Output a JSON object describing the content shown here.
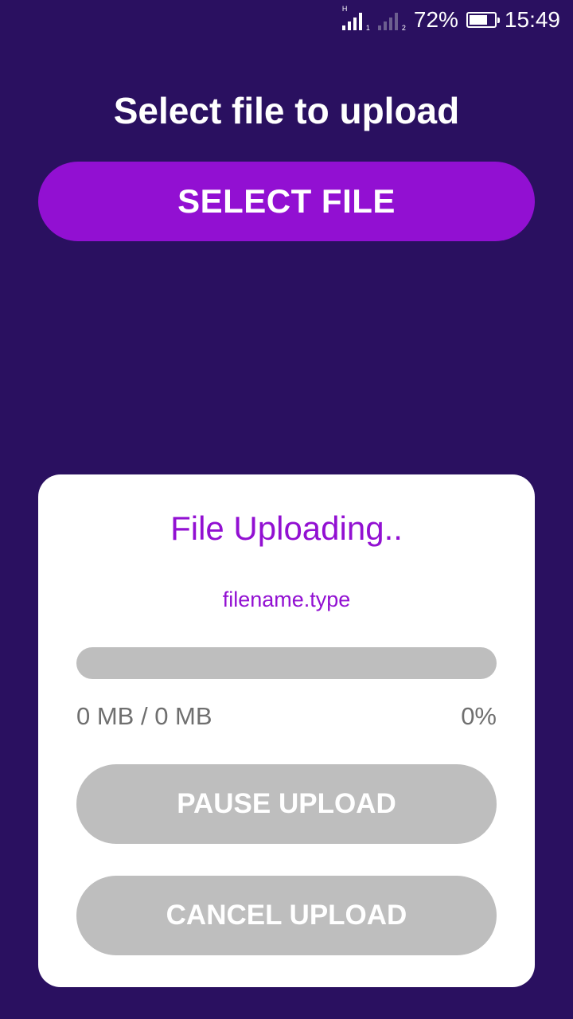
{
  "status_bar": {
    "sim1_label": "H",
    "sim1_index": "1",
    "sim2_index": "2",
    "battery_percent": "72%",
    "battery_level": 0.72,
    "time": "15:49"
  },
  "header": {
    "title": "Select file to upload"
  },
  "select_button": {
    "label": "SELECT FILE"
  },
  "upload_card": {
    "title": "File Uploading..",
    "file_name": "filename.type",
    "progress_fraction": 0,
    "size_text": "0 MB / 0 MB",
    "percent_text": "0%",
    "pause_label": "PAUSE UPLOAD",
    "cancel_label": "CANCEL UPLOAD"
  },
  "colors": {
    "background": "#2a1060",
    "accent": "#9210d2",
    "disabled": "#bebebe",
    "card": "#ffffff",
    "muted_text": "#6f6f6f"
  }
}
